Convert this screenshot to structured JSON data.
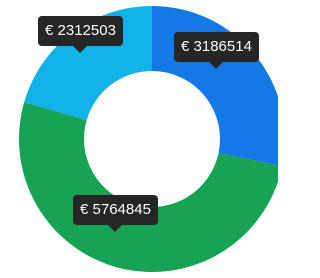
{
  "chart_data": {
    "type": "pie",
    "variant": "donut",
    "currency_prefix": "€",
    "slices": [
      {
        "value": 3186514,
        "label": "€ 3186514",
        "color": "#1478e6"
      },
      {
        "value": 5764845,
        "label": "€ 5764845",
        "color": "#17a353"
      },
      {
        "value": 2312503,
        "label": "€ 2312503",
        "color": "#10b2ea"
      }
    ],
    "legend": "none",
    "tooltips_shown": true
  }
}
